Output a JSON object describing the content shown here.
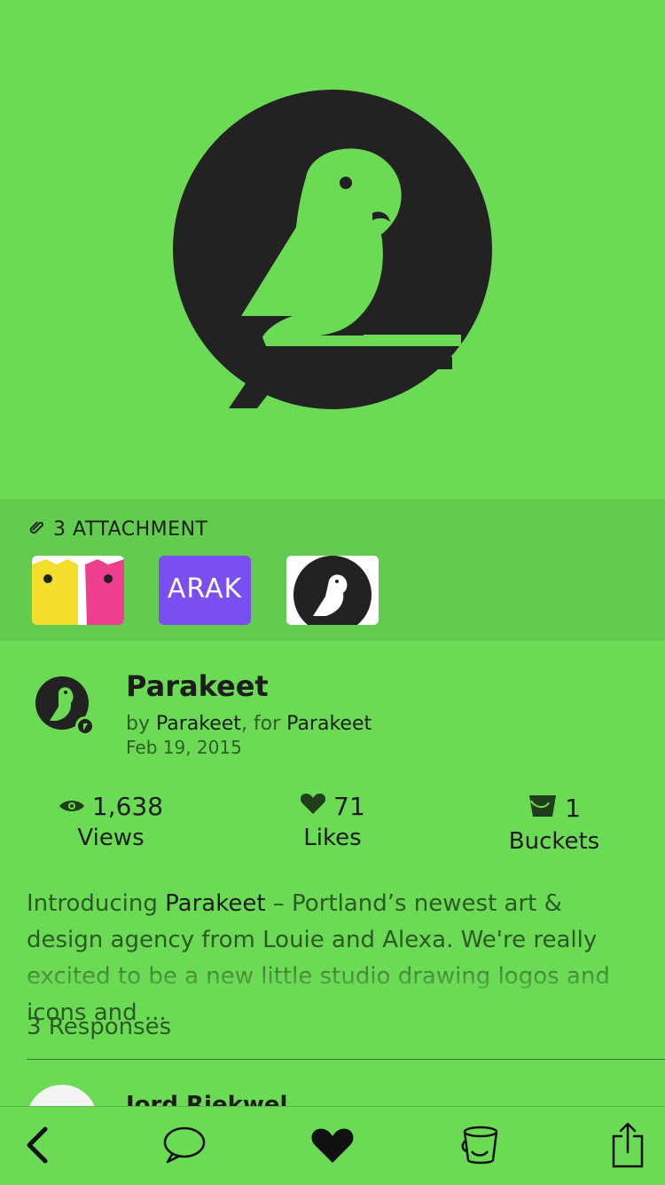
{
  "colors": {
    "background": "#6BDB55",
    "attachment_bar": "#62CC4E",
    "ink": "#222222"
  },
  "attachments": {
    "label": "3 ATTACHMENT",
    "items": [
      {
        "icon": "tshirts-thumbnail"
      },
      {
        "text": "ARAK"
      },
      {
        "icon": "parakeet-logo-thumbnail"
      }
    ]
  },
  "shot": {
    "title": "Parakeet",
    "by_prefix": "by ",
    "author": "Parakeet",
    "for_prefix": ", for ",
    "team": "Parakeet",
    "date": "Feb 19, 2015"
  },
  "stats": [
    {
      "icon": "eye-icon",
      "value": "1,638",
      "label": "Views"
    },
    {
      "icon": "heart-icon",
      "value": "71",
      "label": "Likes"
    },
    {
      "icon": "bucket-icon",
      "value": "1",
      "label": "Buckets"
    }
  ],
  "description": {
    "prefix": "Introducing ",
    "highlight": "Parakeet",
    "rest": " – Portland’s newest art & design agency from Louie and Alexa. We're really excited to be a new little studio drawing logos and icons and ..."
  },
  "responses": {
    "count_label": "3 Responses",
    "first_name": "Jord Riekwel"
  },
  "tabbar": {
    "items": [
      "back-icon",
      "comment-icon",
      "like-icon",
      "bucket-icon",
      "share-icon"
    ]
  }
}
